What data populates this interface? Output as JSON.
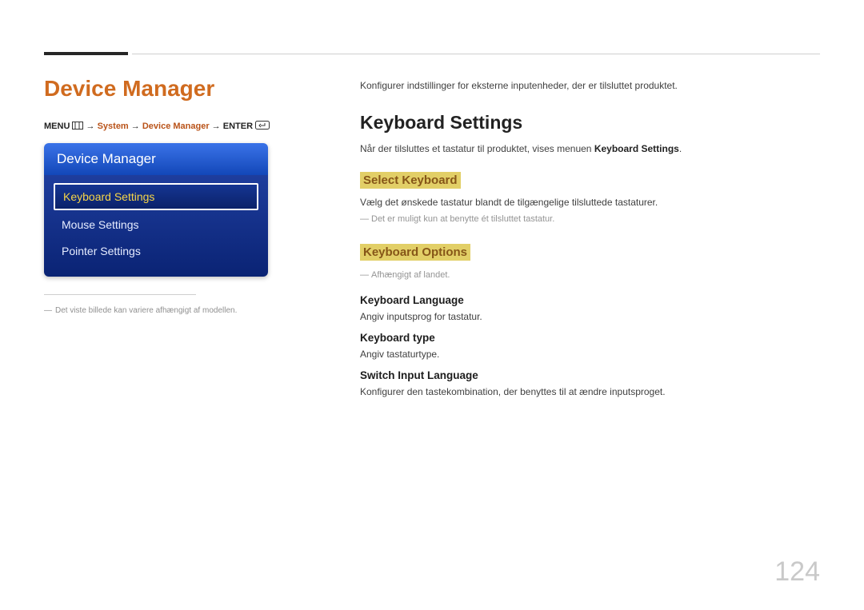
{
  "pageTitle": "Device Manager",
  "breadcrumb": {
    "menu": "MENU",
    "arrow": "→",
    "system": "System",
    "deviceManager": "Device Manager",
    "enter": "ENTER"
  },
  "panel": {
    "header": "Device Manager",
    "items": [
      {
        "label": "Keyboard Settings",
        "selected": true
      },
      {
        "label": "Mouse Settings",
        "selected": false
      },
      {
        "label": "Pointer Settings",
        "selected": false
      }
    ]
  },
  "leftFootnote": "Det viste billede kan variere afhængigt af modellen.",
  "right": {
    "intro": "Konfigurer indstillinger for eksterne inputenheder, der er tilsluttet produktet.",
    "h2": "Keyboard Settings",
    "descPrefix": "Når der tilsluttes et tastatur til produktet, vises menuen ",
    "descBold": "Keyboard Settings",
    "descSuffix": ".",
    "selectKeyboard": {
      "title": "Select Keyboard",
      "desc": "Vælg det ønskede tastatur blandt de tilgængelige tilsluttede tastaturer.",
      "note": "Det er muligt kun at benytte ét tilsluttet tastatur."
    },
    "keyboardOptions": {
      "title": "Keyboard Options",
      "note": "Afhængigt af landet.",
      "items": [
        {
          "h": "Keyboard Language",
          "d": "Angiv inputsprog for tastatur."
        },
        {
          "h": "Keyboard type",
          "d": "Angiv tastaturtype."
        },
        {
          "h": "Switch Input Language",
          "d": "Konfigurer den tastekombination, der benyttes til at ændre inputsproget."
        }
      ]
    }
  },
  "pageNumber": "124"
}
